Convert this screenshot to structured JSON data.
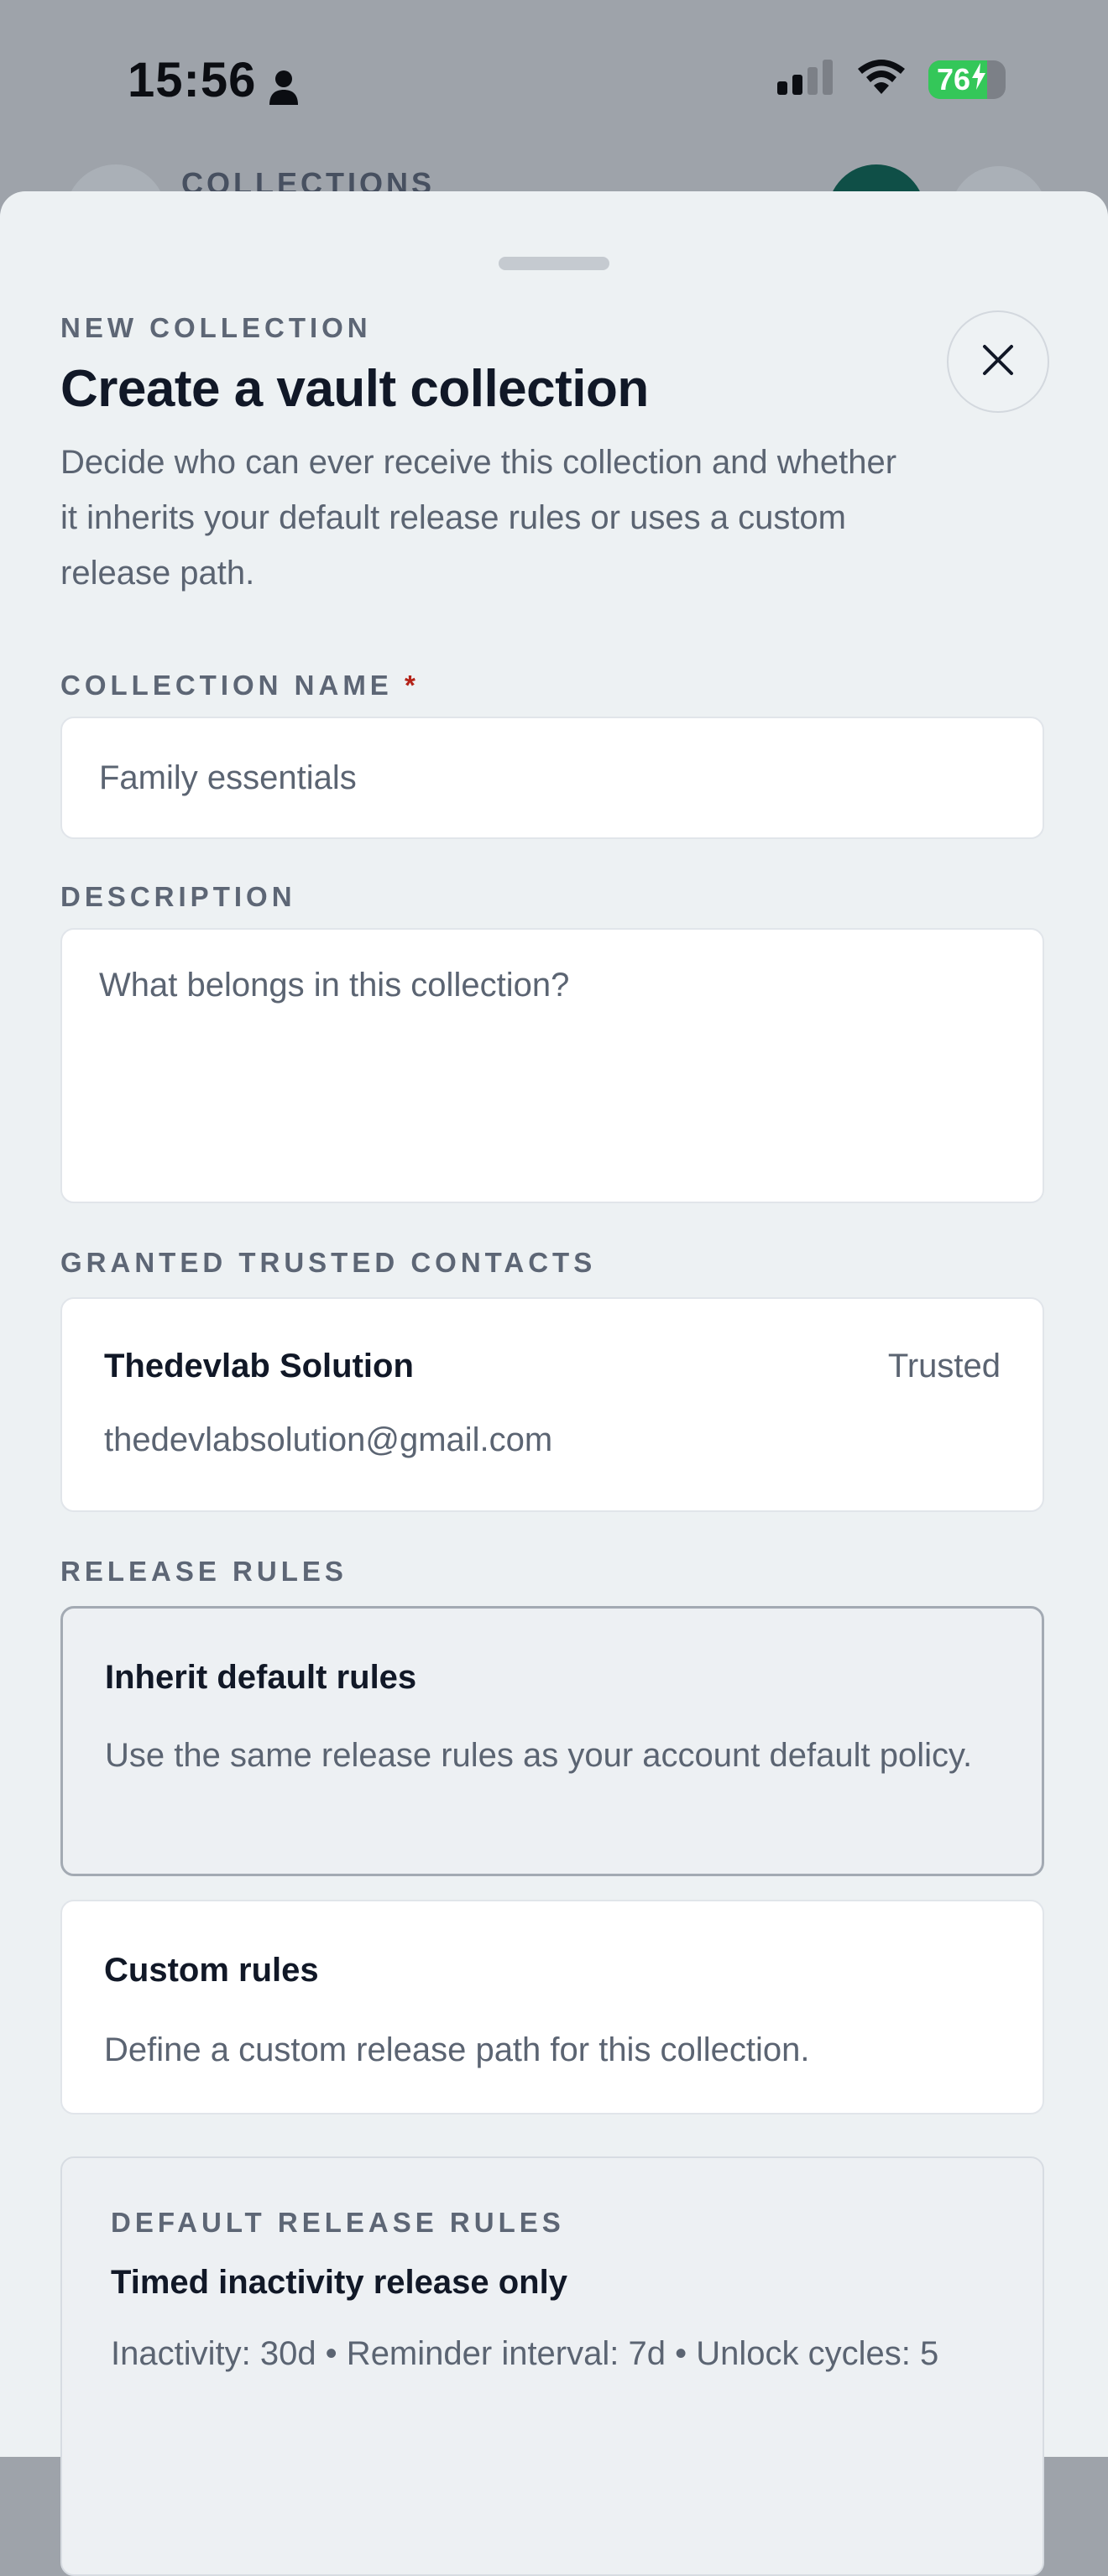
{
  "status_bar": {
    "time": "15:56",
    "battery_level": "76",
    "battery_fraction": 0.76
  },
  "background": {
    "title": "COLLECTIONS"
  },
  "sheet": {
    "eyebrow": "NEW COLLECTION",
    "title": "Create a vault collection",
    "subtitle": "Decide who can ever receive this collection and whether it inherits your default release rules or uses a custom release path.",
    "close_icon": "close-icon"
  },
  "form": {
    "name_label": "COLLECTION NAME",
    "required_mark": "*",
    "name_value": "Family essentials",
    "description_label": "DESCRIPTION",
    "description_placeholder": "What belongs in this collection?",
    "contacts_label": "GRANTED TRUSTED CONTACTS",
    "contact": {
      "name": "Thedevlab Solution",
      "role": "Trusted",
      "email": "thedevlabsolution@gmail.com"
    },
    "release_rules_label": "RELEASE RULES",
    "rules": [
      {
        "title": "Inherit default rules",
        "description": "Use the same release rules as your account default policy.",
        "selected": true
      },
      {
        "title": "Custom rules",
        "description": "Define a custom release path for this collection.",
        "selected": false
      }
    ],
    "defaults": {
      "eyebrow": "DEFAULT RELEASE RULES",
      "title": "Timed inactivity release only",
      "detail": "Inactivity: 30d • Reminder interval: 7d • Unlock cycles: 5"
    }
  },
  "colors": {
    "accent_dark_teal": "#0f4f47",
    "battery_green": "#34c759",
    "required_red": "#b42318"
  }
}
